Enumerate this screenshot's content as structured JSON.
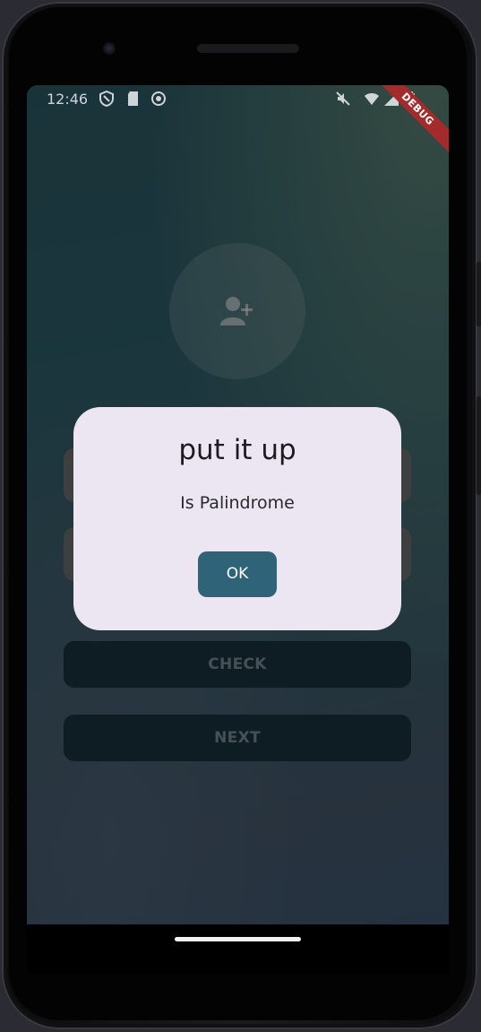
{
  "status_bar": {
    "time": "12:46",
    "debug_banner": "DEBUG",
    "left_icons": [
      "shield-icon",
      "sd-card-icon",
      "sync-icon"
    ],
    "right_icons": [
      "mute-icon",
      "wifi-icon",
      "signal-icon",
      "battery-icon"
    ]
  },
  "avatar": {
    "icon": "add-person-icon"
  },
  "buttons": {
    "check_label": "CHECK",
    "next_label": "NEXT"
  },
  "dialog": {
    "title": "put it up",
    "message": "Is Palindrome",
    "ok_label": "OK"
  },
  "colors": {
    "dialog_bg": "#ece6f2",
    "ok_button": "#2f6377",
    "debug_banner": "#a42b2b"
  }
}
